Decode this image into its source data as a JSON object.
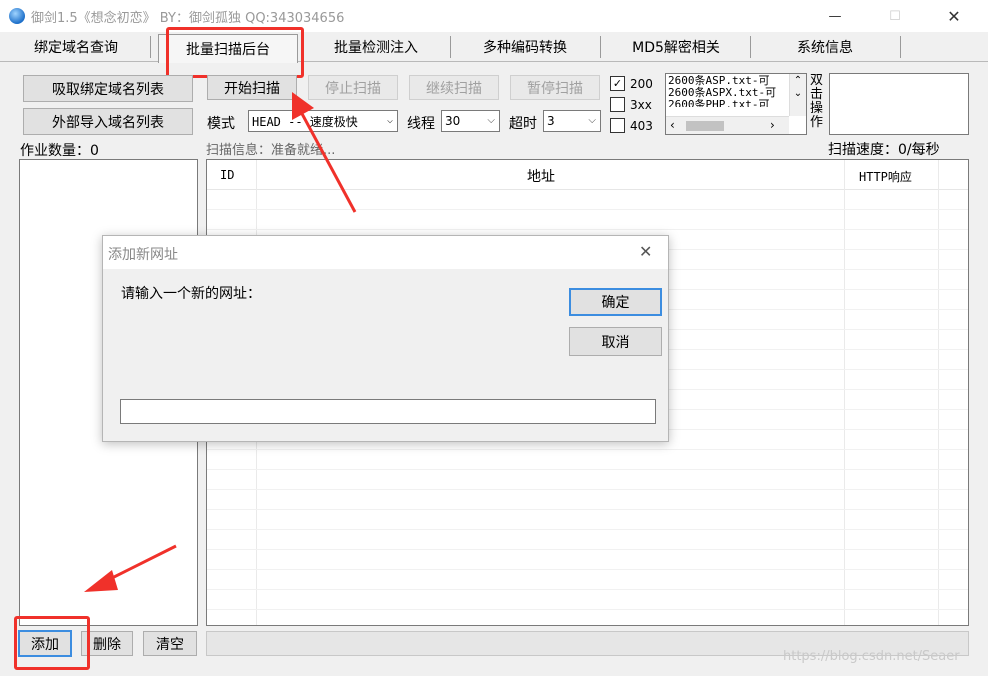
{
  "window": {
    "title": "御剑1.5《想念初恋》 BY：御剑孤独 QQ:343034656",
    "minimize_symbol": "—",
    "maximize_symbol": "☐",
    "close_symbol": "✕"
  },
  "tabs": [
    "绑定域名查询",
    "批量扫描后台",
    "批量检测注入",
    "多种编码转换",
    "MD5解密相关",
    "系统信息"
  ],
  "left": {
    "fetch_button": "吸取绑定域名列表",
    "import_button": "外部导入域名列表",
    "job_count_label": "作业数量：0",
    "add_button": "添加",
    "delete_button": "删除",
    "clear_button": "清空"
  },
  "toolbar": {
    "start": "开始扫描",
    "stop": "停止扫描",
    "continue": "继续扫描",
    "pause": "暂停扫描",
    "mode_label": "模式",
    "mode_value": "HEAD -- 速度极快",
    "threads_label": "线程",
    "threads_value": "30",
    "timeout_label": "超时",
    "timeout_value": "3"
  },
  "status_checks": [
    {
      "label": "200",
      "checked": true
    },
    {
      "label": "3xx",
      "checked": false
    },
    {
      "label": "403",
      "checked": false
    }
  ],
  "dictionary_list": [
    "2600条ASP.txt-可",
    "2600条ASPX.txt-可",
    "2600条PHP.txt-可"
  ],
  "double_click_label": "双击操作",
  "scan_info": "扫描信息：准备就绪...",
  "scan_speed": "扫描速度：0/每秒",
  "table": {
    "columns": [
      "ID",
      "地址",
      "HTTP响应"
    ]
  },
  "dialog": {
    "title": "添加新网址",
    "prompt": "请输入一个新的网址：",
    "ok": "确定",
    "cancel": "取消",
    "input_value": ""
  },
  "watermark": "https://blog.csdn.net/Seaer",
  "colors": {
    "highlight": "#f0312a",
    "accent": "#3c8de0"
  }
}
